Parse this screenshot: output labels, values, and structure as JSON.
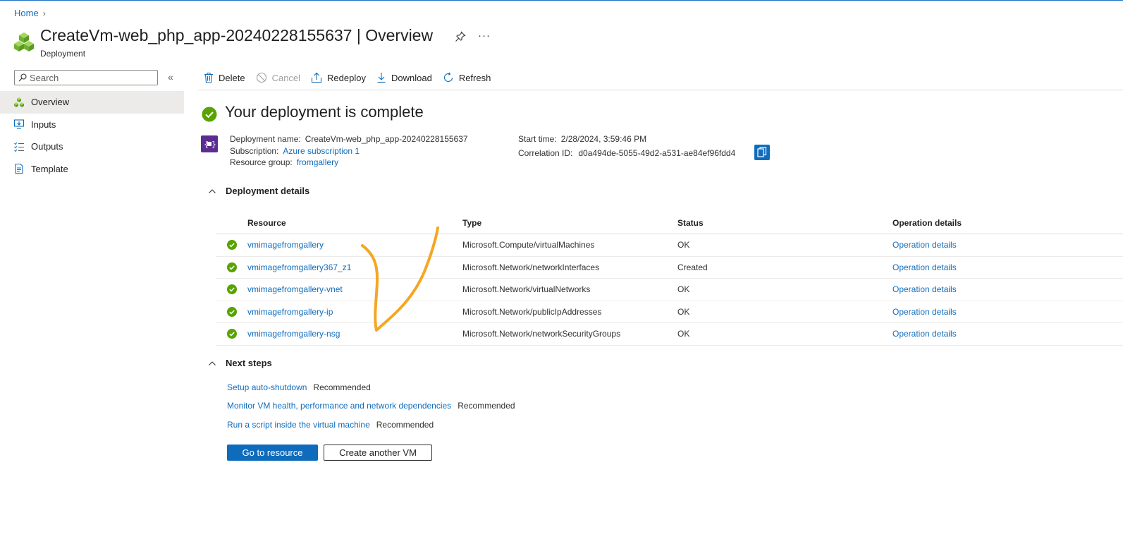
{
  "breadcrumb": {
    "home": "Home"
  },
  "header": {
    "title": "CreateVm-web_php_app-20240228155637",
    "separator": "|",
    "view": "Overview",
    "subtitle": "Deployment"
  },
  "sidebar": {
    "search_placeholder": "Search",
    "items": [
      {
        "label": "Overview",
        "icon": "overview-cubes-icon",
        "active": true
      },
      {
        "label": "Inputs",
        "icon": "inputs-icon"
      },
      {
        "label": "Outputs",
        "icon": "outputs-icon"
      },
      {
        "label": "Template",
        "icon": "template-icon"
      }
    ]
  },
  "toolbar": {
    "delete": "Delete",
    "cancel": "Cancel",
    "redeploy": "Redeploy",
    "download": "Download",
    "refresh": "Refresh"
  },
  "status": {
    "title": "Your deployment is complete"
  },
  "info": {
    "deployment_name_label": "Deployment name:",
    "deployment_name": "CreateVm-web_php_app-20240228155637",
    "subscription_label": "Subscription:",
    "subscription": "Azure subscription 1",
    "resource_group_label": "Resource group:",
    "resource_group": "fromgallery",
    "start_time_label": "Start time:",
    "start_time": "2/28/2024, 3:59:46 PM",
    "correlation_label": "Correlation ID:",
    "correlation_id": "d0a494de-5055-49d2-a531-ae84ef96fdd4"
  },
  "details": {
    "heading": "Deployment details",
    "columns": [
      "Resource",
      "Type",
      "Status",
      "Operation details"
    ],
    "rows": [
      {
        "resource": "vmimagefromgallery",
        "type": "Microsoft.Compute/virtualMachines",
        "status": "OK",
        "op": "Operation details"
      },
      {
        "resource": "vmimagefromgallery367_z1",
        "type": "Microsoft.Network/networkInterfaces",
        "status": "Created",
        "op": "Operation details"
      },
      {
        "resource": "vmimagefromgallery-vnet",
        "type": "Microsoft.Network/virtualNetworks",
        "status": "OK",
        "op": "Operation details"
      },
      {
        "resource": "vmimagefromgallery-ip",
        "type": "Microsoft.Network/publicIpAddresses",
        "status": "OK",
        "op": "Operation details"
      },
      {
        "resource": "vmimagefromgallery-nsg",
        "type": "Microsoft.Network/networkSecurityGroups",
        "status": "OK",
        "op": "Operation details"
      }
    ]
  },
  "next_steps": {
    "heading": "Next steps",
    "items": [
      {
        "link": "Setup auto-shutdown",
        "tag": "Recommended"
      },
      {
        "link": "Monitor VM health, performance and network dependencies",
        "tag": "Recommended"
      },
      {
        "link": "Run a script inside the virtual machine",
        "tag": "Recommended"
      }
    ]
  },
  "buttons": {
    "go_to_resource": "Go to resource",
    "create_another": "Create another VM"
  },
  "colors": {
    "accent": "#0f6cbd",
    "success": "#57a300",
    "annotation": "#f5a623"
  }
}
